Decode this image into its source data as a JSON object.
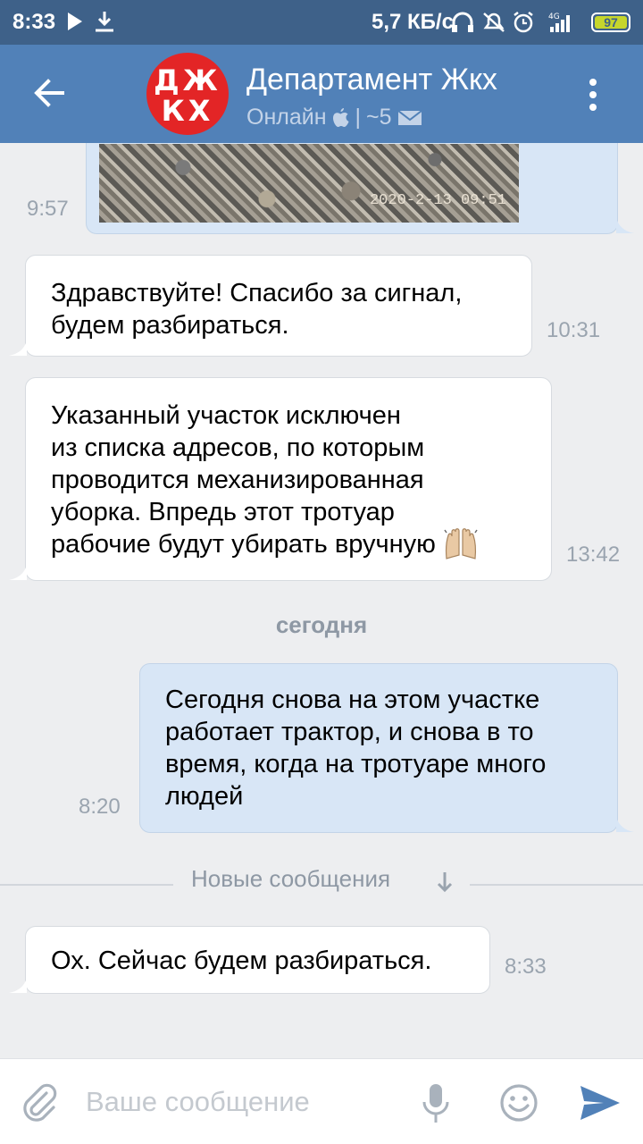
{
  "status_bar": {
    "time": "8:33",
    "network_speed": "5,7 КБ/с",
    "signal_label": "4G",
    "battery": "97"
  },
  "header": {
    "avatar_line1": "ДЖ",
    "avatar_line2": "КХ",
    "title": "Департамент Жкх",
    "status": "Онлайн",
    "separator": "|",
    "count": "~5",
    "colors": {
      "bar": "#5181b8",
      "status_bar": "#3e6189",
      "avatar": "#e32526"
    }
  },
  "messages": [
    {
      "type": "photo",
      "direction": "out",
      "photo_stamp": "2020-2-13 09:51",
      "time": "9:57"
    },
    {
      "type": "text",
      "direction": "in",
      "lines": [
        "Здравствуйте! Спасибо за сигнал,",
        "будем разбираться."
      ],
      "time": "10:31"
    },
    {
      "type": "text",
      "direction": "in",
      "lines": [
        "Указанный участок исключен",
        "из списка адресов, по которым",
        "проводится механизированная",
        "уборка. Впредь этот тротуар",
        "рабочие будут убирать вручную"
      ],
      "emoji": "raised-hands",
      "time": "13:42"
    },
    {
      "type": "text",
      "direction": "out",
      "lines": [
        "Сегодня снова на этом участке",
        "работает трактор, и снова в то",
        "время, когда на тротуаре много",
        "людей"
      ],
      "time": "8:20"
    },
    {
      "type": "text",
      "direction": "in",
      "lines": [
        "Ох. Сейчас будем разбираться."
      ],
      "time": "8:33"
    }
  ],
  "day_separator": "сегодня",
  "new_messages_label": "Новые сообщения",
  "composer": {
    "placeholder": "Ваше сообщение",
    "value": ""
  }
}
